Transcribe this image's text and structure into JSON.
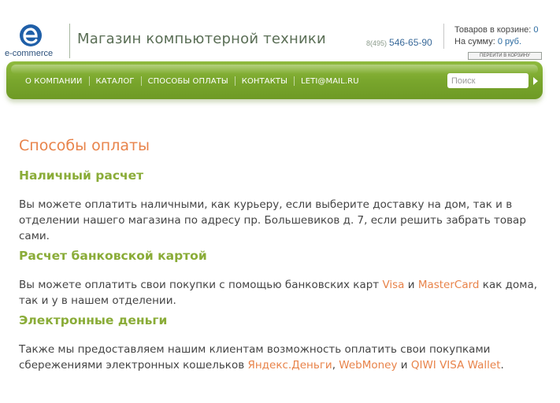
{
  "header": {
    "logo_text": "e-commerce",
    "store_title": "Магазин компьютерной техники",
    "phone_code": "8(495)",
    "phone_number": "546-65-90",
    "cart": {
      "items_label": "Товаров в корзине:",
      "items_value": "0",
      "sum_label": "На сумму:",
      "sum_value": "0 руб.",
      "go_button": "ПЕРЕЙТИ В КОРЗИНУ"
    }
  },
  "nav": {
    "items": [
      {
        "label": "О компании"
      },
      {
        "label": "Каталог"
      },
      {
        "label": "Способы оплаты"
      },
      {
        "label": "Контакты"
      },
      {
        "label": "leti@mail.ru"
      }
    ],
    "search_placeholder": "Поиск"
  },
  "content": {
    "page_title": "Способы оплаты",
    "sections": [
      {
        "title": "Наличный расчет",
        "text": "Вы можете оплатить наличными, как курьеру, если выберите доставку на дом, так и в отделении нашего магазина по адресу пр. Большевиков д. 7, если решить забрать товар сами."
      },
      {
        "title": "Расчет банковской картой",
        "text_before": "Вы можете оплатить свои покупки с помощью банковских карт ",
        "link1": "Visa",
        "text_mid": " и ",
        "link2": "MasterCard",
        "text_after": " как дома, так и у в нашем отделении."
      },
      {
        "title": "Электронные деньги",
        "text_before": "Также мы предоставляем нашим клиентам возможность оплатить свои покупками сбережениями электронных кошельков ",
        "link1": "Яндекс.Деньги",
        "sep1": ", ",
        "link2": "WebMoney",
        "sep2": " и ",
        "link3": "QIWI VISA Wallet",
        "text_after": "."
      }
    ]
  },
  "colors": {
    "accent_orange": "#e8834a",
    "accent_green": "#8aac38",
    "nav_green": "#78a52c",
    "link_blue": "#2a6aa0"
  },
  "icons": {
    "logo": "e-commerce-logo-icon",
    "search_submit": "arrow-right-icon"
  }
}
